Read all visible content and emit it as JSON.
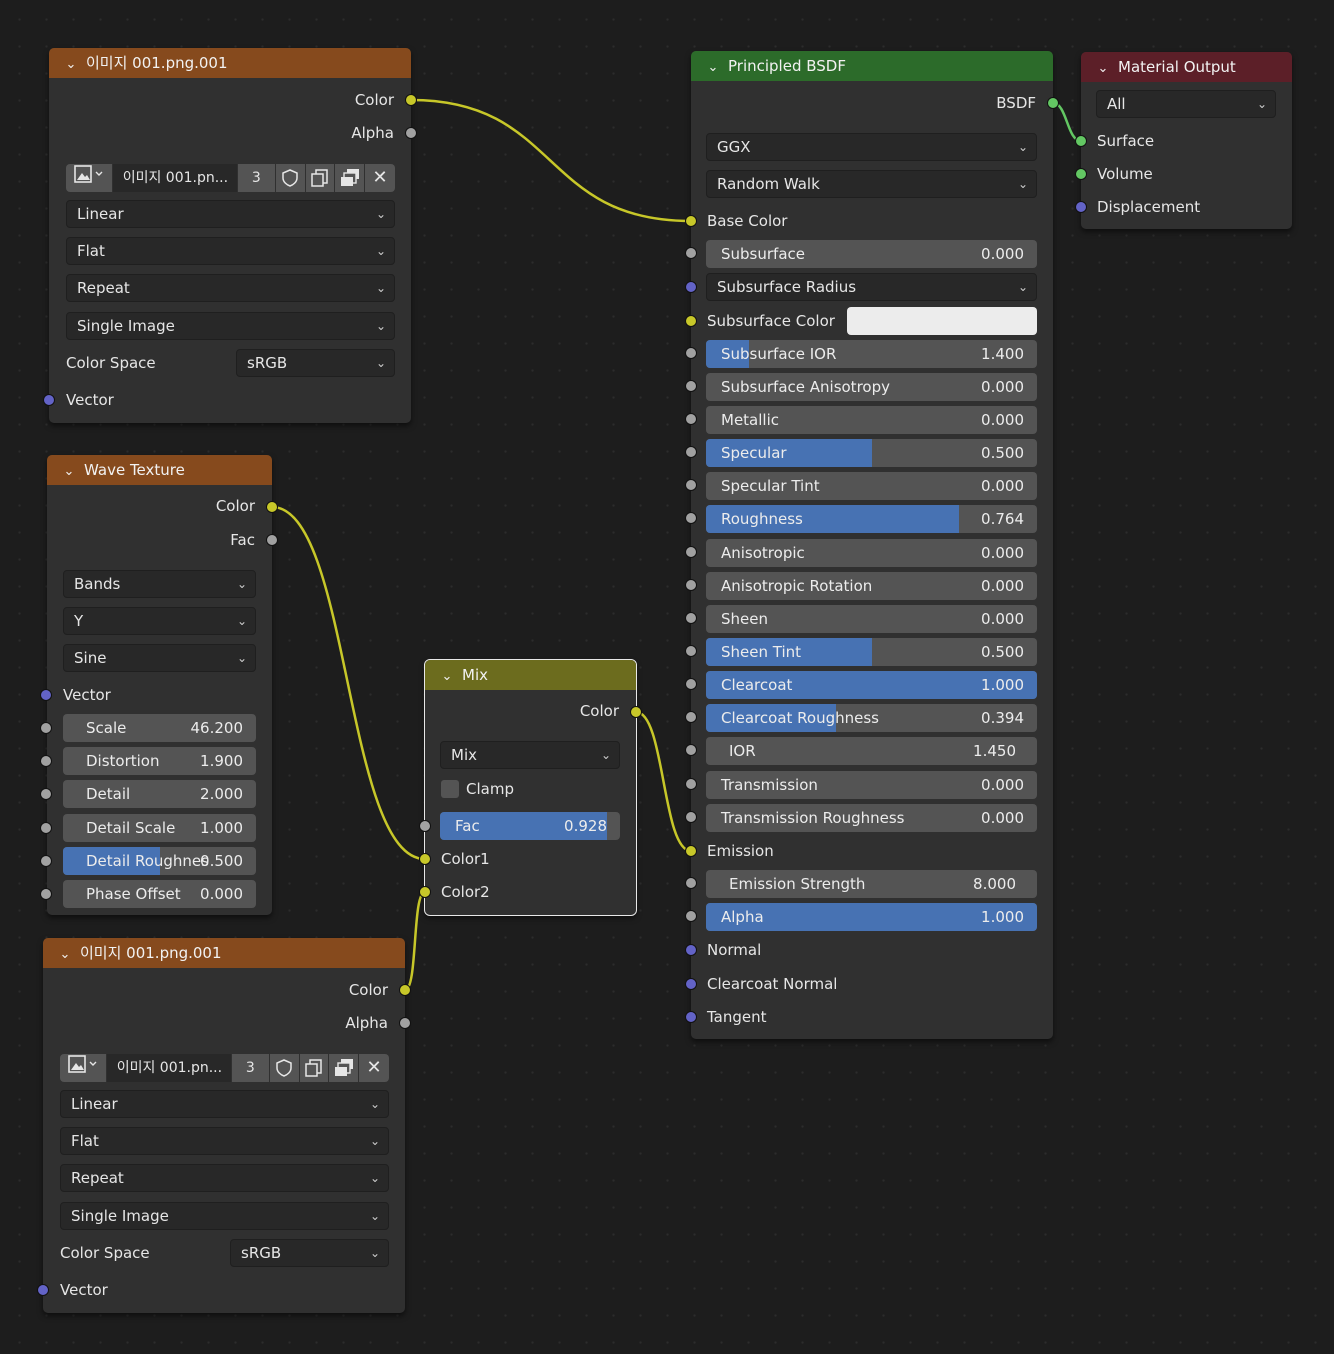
{
  "colors": {
    "wire": "#c7c729",
    "texture_header": "#864a1d",
    "shader_header": "#2c6b2a",
    "output_header": "#5c1f28",
    "mix_header": "#6c6c1e",
    "slider_fill": "#4772b3"
  },
  "image1": {
    "title": "이미지 001.png.001",
    "out_color": "Color",
    "out_alpha": "Alpha",
    "image_name": "이미지 001.pn...",
    "users": "3",
    "interpolation": "Linear",
    "projection": "Flat",
    "extension": "Repeat",
    "source": "Single Image",
    "colorspace_label": "Color Space",
    "colorspace": "sRGB",
    "in_vector": "Vector"
  },
  "image2": {
    "title": "이미지 001.png.001",
    "out_color": "Color",
    "out_alpha": "Alpha",
    "image_name": "이미지 001.pn...",
    "users": "3",
    "interpolation": "Linear",
    "projection": "Flat",
    "extension": "Repeat",
    "source": "Single Image",
    "colorspace_label": "Color Space",
    "colorspace": "sRGB",
    "in_vector": "Vector"
  },
  "wave": {
    "title": "Wave Texture",
    "out_color": "Color",
    "out_fac": "Fac",
    "type": "Bands",
    "direction": "Y",
    "profile": "Sine",
    "in_vector": "Vector",
    "fields": [
      {
        "label": "Scale",
        "value": "46.200",
        "fill": 0
      },
      {
        "label": "Distortion",
        "value": "1.900",
        "fill": 0
      },
      {
        "label": "Detail",
        "value": "2.000",
        "fill": 0
      },
      {
        "label": "Detail Scale",
        "value": "1.000",
        "fill": 0
      },
      {
        "label": "Detail Roughnes",
        "value": "0.500",
        "fill": 0.5
      },
      {
        "label": "Phase Offset",
        "value": "0.000",
        "fill": 0
      }
    ]
  },
  "mix": {
    "title": "Mix",
    "out_color": "Color",
    "blend": "Mix",
    "clamp": "Clamp",
    "fac_label": "Fac",
    "fac_value": "0.928",
    "fac_fill": 0.928,
    "in_color1": "Color1",
    "in_color2": "Color2"
  },
  "bsdf": {
    "title": "Principled BSDF",
    "out_bsdf": "BSDF",
    "distribution": "GGX",
    "subsurface_method": "Random Walk",
    "base_color": "Base Color",
    "subsurface_radius": "Subsurface Radius",
    "subsurface_color": "Subsurface Color",
    "emission": "Emission",
    "normal": "Normal",
    "clearcoat_normal": "Clearcoat Normal",
    "tangent": "Tangent",
    "fields": {
      "subsurface": {
        "label": "Subsurface",
        "value": "0.000",
        "fill": 0
      },
      "subsurface_ior": {
        "label": "Subsurface IOR",
        "value": "1.400",
        "fill": 0.13
      },
      "subsurface_anisotropy": {
        "label": "Subsurface Anisotropy",
        "value": "0.000",
        "fill": 0
      },
      "metallic": {
        "label": "Metallic",
        "value": "0.000",
        "fill": 0
      },
      "specular": {
        "label": "Specular",
        "value": "0.500",
        "fill": 0.5
      },
      "specular_tint": {
        "label": "Specular Tint",
        "value": "0.000",
        "fill": 0
      },
      "roughness": {
        "label": "Roughness",
        "value": "0.764",
        "fill": 0.764
      },
      "anisotropic": {
        "label": "Anisotropic",
        "value": "0.000",
        "fill": 0
      },
      "anisotropic_rotation": {
        "label": "Anisotropic Rotation",
        "value": "0.000",
        "fill": 0
      },
      "sheen": {
        "label": "Sheen",
        "value": "0.000",
        "fill": 0
      },
      "sheen_tint": {
        "label": "Sheen Tint",
        "value": "0.500",
        "fill": 0.5
      },
      "clearcoat": {
        "label": "Clearcoat",
        "value": "1.000",
        "fill": 1
      },
      "clearcoat_roughness": {
        "label": "Clearcoat Roughness",
        "value": "0.394",
        "fill": 0.394
      },
      "ior": {
        "label": "IOR",
        "value": "1.450",
        "fill": 0
      },
      "transmission": {
        "label": "Transmission",
        "value": "0.000",
        "fill": 0
      },
      "transmission_roughness": {
        "label": "Transmission Roughness",
        "value": "0.000",
        "fill": 0
      },
      "emission_strength": {
        "label": "Emission Strength",
        "value": "8.000",
        "fill": 0
      },
      "alpha": {
        "label": "Alpha",
        "value": "1.000",
        "fill": 1
      }
    }
  },
  "output": {
    "title": "Material Output",
    "target": "All",
    "in_surface": "Surface",
    "in_volume": "Volume",
    "in_displacement": "Displacement"
  }
}
